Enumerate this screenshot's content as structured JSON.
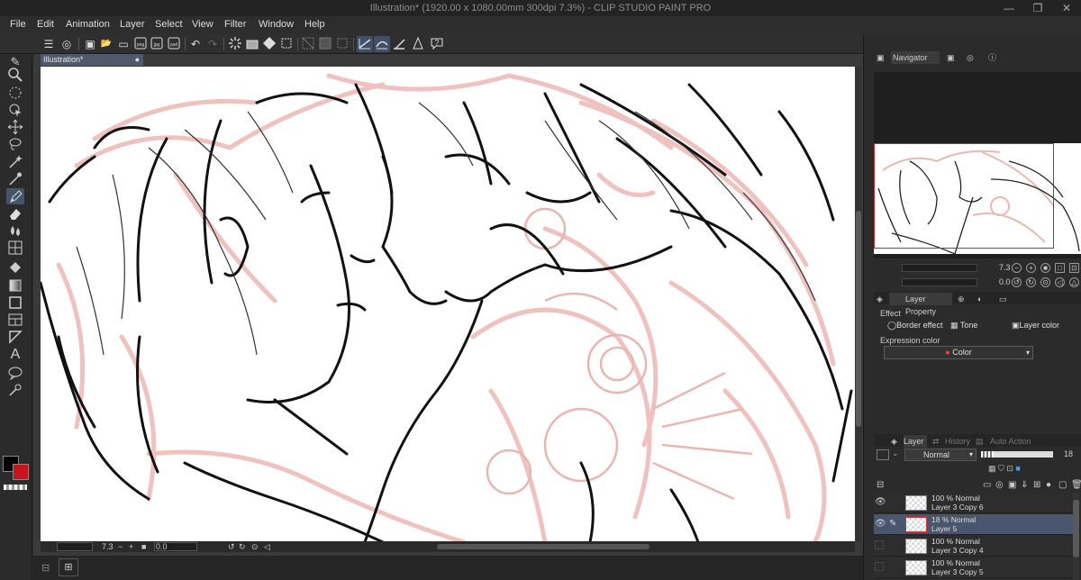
{
  "window": {
    "title": "Illustration* (1920.00 x 1080.00mm 300dpi 7.3%) - CLIP STUDIO PAINT PRO",
    "minimize": "—",
    "maximize": "❐",
    "close": "✕"
  },
  "menu": [
    "File",
    "Edit",
    "Animation",
    "Layer",
    "Select",
    "View",
    "Filter",
    "Window",
    "Help"
  ],
  "command_bar": {
    "icons": [
      "menu-icon",
      "clip-studio-icon",
      "new-icon",
      "open-icon",
      "save-icon",
      "save-as-icon",
      "export-icon",
      "export-png-icon",
      "export-psd-icon",
      "undo-icon",
      "redo-icon",
      "clear-icon",
      "fill-icon",
      "transform-icon",
      "crop-icon",
      "hide-selection-icon",
      "select-all-icon",
      "deselect-icon",
      "snap-ruler-icon",
      "snap-special-ruler-icon",
      "snap-grid-icon",
      "help-icon"
    ],
    "glyphs": {
      "menu": "☰",
      "clip": "◎",
      "new": "▣",
      "open": "📂",
      "save": "▭",
      "undo": "↶",
      "redo": "↷",
      "help": "?"
    }
  },
  "toolbox": {
    "icons": [
      "pen-sub-icon",
      "zoom-icon",
      "move-icon",
      "object-icon",
      "lasso-icon",
      "magic-wand-icon",
      "eyedropper-icon",
      "pen-icon",
      "eraser-icon",
      "blend-icon",
      "figure-icon",
      "fill-icon",
      "gradient-icon",
      "frame-icon",
      "ruler-icon",
      "text-icon",
      "balloon-icon",
      "correct-line-icon"
    ],
    "glyphs": [
      "✎",
      "🔍",
      "✥",
      "⛶",
      "⌖",
      "✶",
      "⁄",
      "✒",
      "▭",
      "💧",
      "▦",
      "⛋",
      "▩",
      "▢",
      "◤",
      "A",
      "◯",
      "✐"
    ],
    "active_index": 7,
    "main_color": "#050505",
    "sub_color": "#c8141c"
  },
  "document": {
    "tab_label": "Illustration*",
    "tab_dot": "●"
  },
  "canvas_status": {
    "zoom": "7.3",
    "zoom_minus": "−",
    "zoom_plus": "+",
    "angle": "0.0"
  },
  "bottom": {
    "panel_button": "⊞"
  },
  "navigator": {
    "tab": "Navigator",
    "zoom": "7.3",
    "angle": "0.0"
  },
  "layer_property": {
    "tab": "Layer Property",
    "effect_label": "Effect",
    "border_effect": "Border effect",
    "tone": "Tone",
    "layer_color": "Layer color",
    "expression_label": "Expression color",
    "expression_value": "Color"
  },
  "layer_panel": {
    "tabs": [
      "Layer",
      "History",
      "Auto Action"
    ],
    "blend_mode": "Normal",
    "opacity": "18",
    "opacity_fraction": 0.18,
    "layers": [
      {
        "line1": "100 % Normal",
        "line2": "Layer 3 Copy 6",
        "visible": true,
        "editing": false,
        "selected": false,
        "red": false
      },
      {
        "line1": "18 % Normal",
        "line2": "Layer 5",
        "visible": true,
        "editing": true,
        "selected": true,
        "red": true
      },
      {
        "line1": "100 % Normal",
        "line2": "Layer 3 Copy 4",
        "visible": false,
        "editing": false,
        "selected": false,
        "red": false
      },
      {
        "line1": "100 % Normal",
        "line2": "Layer 3 Copy 5",
        "visible": false,
        "editing": false,
        "selected": false,
        "red": false
      }
    ]
  }
}
